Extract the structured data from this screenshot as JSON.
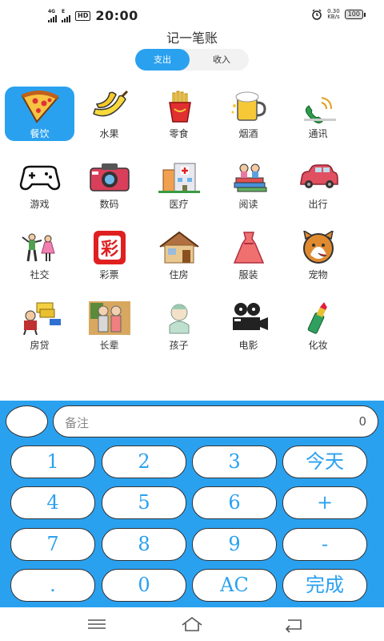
{
  "status_bar": {
    "network": "4G",
    "network2": "E",
    "hd": "HD",
    "time": "20:00",
    "speed_value": "0.30",
    "speed_unit": "KB/s",
    "battery": "100"
  },
  "header": {
    "title": "记一笔账",
    "tab_expense": "支出",
    "tab_income": "收入"
  },
  "categories": [
    {
      "label": "餐饮",
      "icon": "pizza-icon",
      "selected": true
    },
    {
      "label": "水果",
      "icon": "banana-icon"
    },
    {
      "label": "零食",
      "icon": "fries-icon"
    },
    {
      "label": "烟酒",
      "icon": "beer-icon"
    },
    {
      "label": "通讯",
      "icon": "phone-icon"
    },
    {
      "label": "游戏",
      "icon": "gamepad-icon"
    },
    {
      "label": "数码",
      "icon": "camera-icon"
    },
    {
      "label": "医疗",
      "icon": "hospital-icon"
    },
    {
      "label": "阅读",
      "icon": "books-icon"
    },
    {
      "label": "出行",
      "icon": "car-icon"
    },
    {
      "label": "社交",
      "icon": "people-icon"
    },
    {
      "label": "彩票",
      "icon": "lottery-icon"
    },
    {
      "label": "住房",
      "icon": "house-icon"
    },
    {
      "label": "服装",
      "icon": "dress-icon"
    },
    {
      "label": "宠物",
      "icon": "dog-icon"
    },
    {
      "label": "房贷",
      "icon": "loan-icon"
    },
    {
      "label": "长辈",
      "icon": "elders-icon"
    },
    {
      "label": "孩子",
      "icon": "baby-icon"
    },
    {
      "label": "电影",
      "icon": "film-camera-icon"
    },
    {
      "label": "化妆",
      "icon": "lipstick-icon"
    }
  ],
  "keypad": {
    "note_placeholder": "备注",
    "amount": "0",
    "keys": [
      "1",
      "2",
      "3",
      "今天",
      "4",
      "5",
      "6",
      "+",
      "7",
      "8",
      "9",
      "-",
      ".",
      "0",
      "AC",
      "完成"
    ]
  }
}
